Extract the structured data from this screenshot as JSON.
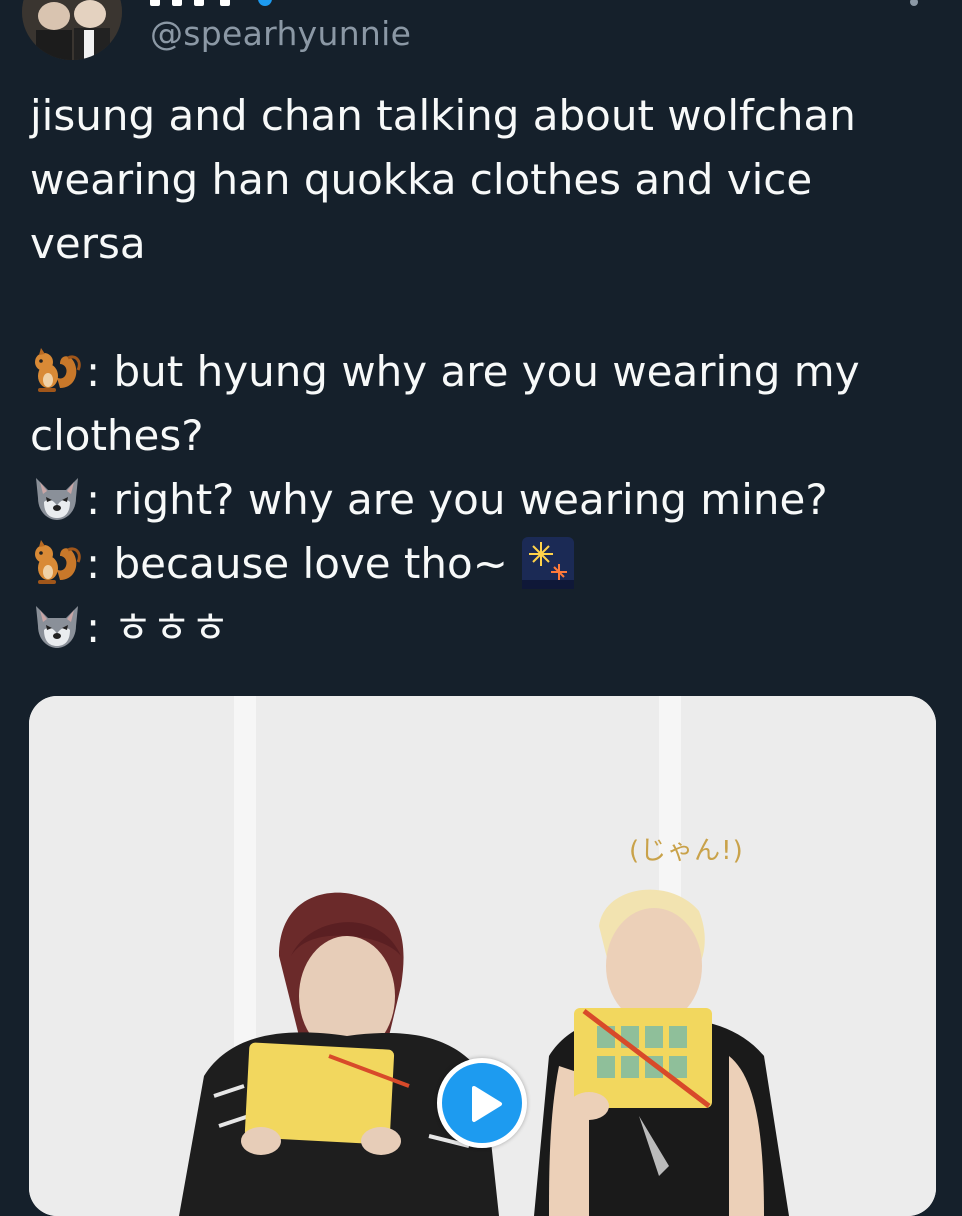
{
  "tweet": {
    "handle": "@spearhyunnie",
    "text_lines": [
      "jisung and chan talking about wolfchan",
      "wearing han quokka clothes and vice",
      "versa"
    ],
    "dialogue": [
      {
        "speaker_icon": "squirrel-emoji-icon",
        "text": ": but hyung why are you wearing my"
      },
      {
        "speaker_icon": "",
        "text": "clothes?"
      },
      {
        "speaker_icon": "wolf-emoji-icon",
        "text": ": right? why are you wearing mine?"
      },
      {
        "speaker_icon": "squirrel-emoji-icon",
        "text": ": because love tho~ ",
        "trailing_icon": "fireworks-emoji-icon"
      },
      {
        "speaker_icon": "wolf-emoji-icon",
        "text": ": ㅎㅎㅎ"
      }
    ]
  },
  "media": {
    "type": "video",
    "caption_overlay": "(じゃん!)",
    "play_icon": "play-icon"
  },
  "icons": {
    "more": "more-vertical-icon",
    "avatar": "avatar"
  },
  "colors": {
    "background": "#15202b",
    "text": "#f7f9f9",
    "muted": "#8b98a5",
    "accent": "#1d9bf0"
  }
}
